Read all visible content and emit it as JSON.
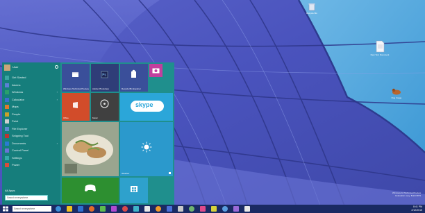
{
  "desktop": {
    "icons": [
      {
        "name": "recycle-bin",
        "label": "Recycle Bin"
      },
      {
        "name": "file",
        "label": "New Text Document"
      },
      {
        "name": "dog",
        "label": "Dog Image"
      }
    ],
    "watermark_lines": [
      "Windows 10 Technical Preview",
      "Evaluation copy. Build 9879"
    ]
  },
  "start_menu": {
    "user_name": "User",
    "items": [
      {
        "label": "Get Started",
        "color": "#3aa5a3",
        "has_arrow": false
      },
      {
        "label": "Alarms",
        "color": "#5a7fd6",
        "has_arrow": false
      },
      {
        "label": "Windows",
        "color": "#2aa06c",
        "has_arrow": true
      },
      {
        "label": "Calculator",
        "color": "#3b6fcf",
        "has_arrow": true
      },
      {
        "label": "Maps",
        "color": "#e07a2e",
        "has_arrow": false
      },
      {
        "label": "People",
        "color": "#c9a12a",
        "has_arrow": false
      },
      {
        "label": "Paint",
        "color": "#d0d0d0",
        "has_arrow": false
      },
      {
        "label": "File Explorer",
        "color": "#5b8bd0",
        "has_arrow": false
      },
      {
        "label": "Snipping Tool",
        "color": "#b33",
        "has_arrow": false
      },
      {
        "label": "Documents",
        "color": "#2a7bd3",
        "has_arrow": true
      },
      {
        "label": "Control Panel",
        "color": "#6a73d8",
        "has_arrow": false
      },
      {
        "label": "Settings",
        "color": "#3aa",
        "has_arrow": false
      },
      {
        "label": "Power",
        "color": "#d94c3c",
        "has_arrow": false
      }
    ],
    "all_apps_label": "All Apps",
    "search_placeholder": "Search everywhere",
    "tiles": [
      {
        "name": "tile-tech-preview",
        "label": "Windows Technical Preview",
        "color": "#3a4f9a"
      },
      {
        "name": "tile-photoshop",
        "label": "Adobe Photoshop",
        "color": "#2f3d78"
      },
      {
        "name": "tile-recycle",
        "label": "Recycle Bin Explorer",
        "color": "#3a4f9a"
      },
      {
        "name": "tile-office",
        "label": "Office",
        "color": "#d24c2a"
      },
      {
        "name": "tile-music",
        "label": "Music",
        "color": "#404040"
      },
      {
        "name": "tile-skype",
        "label": "skype",
        "color": "#2ba6d9"
      },
      {
        "name": "tile-food",
        "label": "",
        "color": "#c7c8b7"
      },
      {
        "name": "tile-weather",
        "label": "Weather",
        "color": "#2b99cc"
      },
      {
        "name": "tile-xbox",
        "label": "",
        "color": "#2d8f30"
      },
      {
        "name": "tile-store",
        "label": "",
        "color": "#2ea1cc"
      }
    ],
    "small_tile_color": "#c23f9e"
  },
  "taskbar": {
    "search_placeholder": "Search everywhere",
    "tray_lines": [
      "8:41 PM",
      "2/12/2015"
    ]
  }
}
